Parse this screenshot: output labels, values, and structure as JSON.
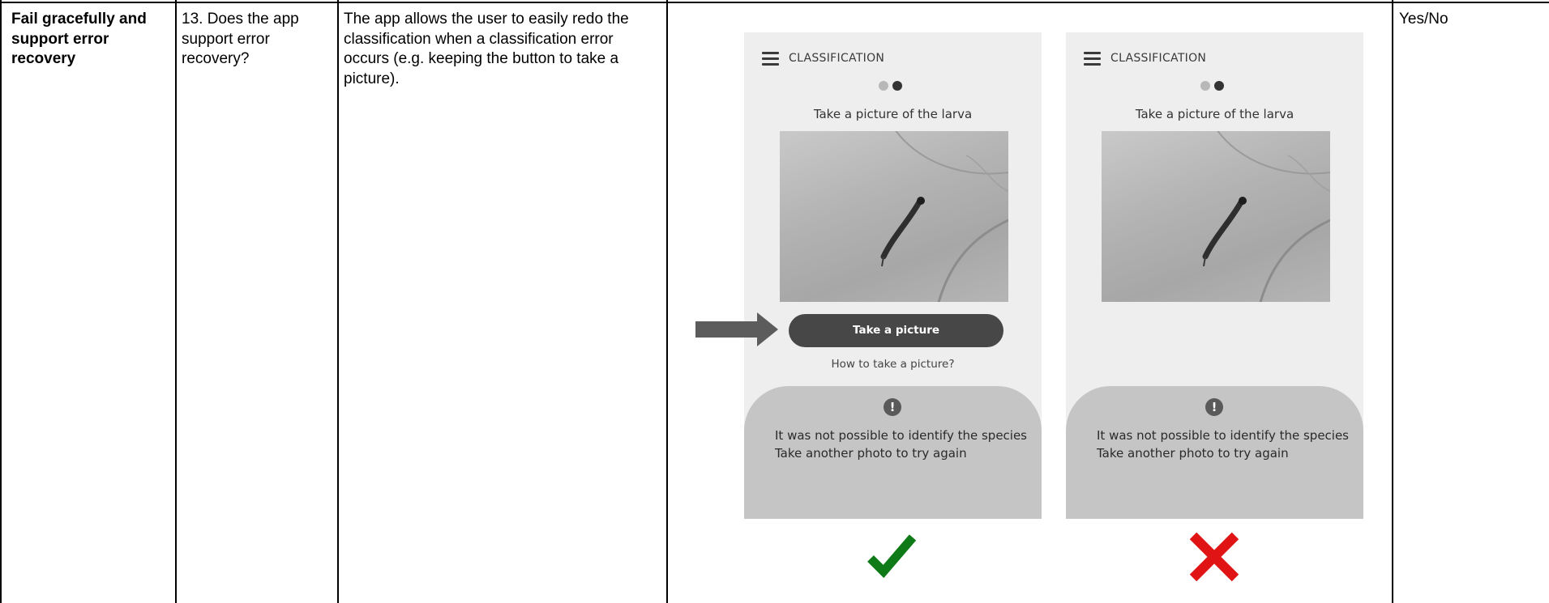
{
  "table": {
    "principle": "Fail gracefully and support error recovery",
    "question": "13. Does the app support error recovery?",
    "description": "The app allows the user to easily redo the classification when a classification error occurs (e.g. keeping the button to take a picture).",
    "answer": "Yes/No"
  },
  "mockups": [
    {
      "header_title": "CLASSIFICATION",
      "instruction": "Take a picture of the larva",
      "button_label": "Take a picture",
      "help_link": "How to take a picture?",
      "error_line1": "It was not possible to identify the species",
      "error_line2": "Take another photo to try again",
      "verdict_icon": "green-checkmark-icon",
      "verdict_color": "#0f7a18"
    },
    {
      "header_title": "CLASSIFICATION",
      "instruction": "Take a picture of the larva",
      "error_line1": "It was not possible to identify the species",
      "error_line2": "Take another photo to try again",
      "verdict_icon": "red-cross-icon",
      "verdict_color": "#e01414"
    }
  ],
  "pointer_icon": "right-arrow-icon"
}
